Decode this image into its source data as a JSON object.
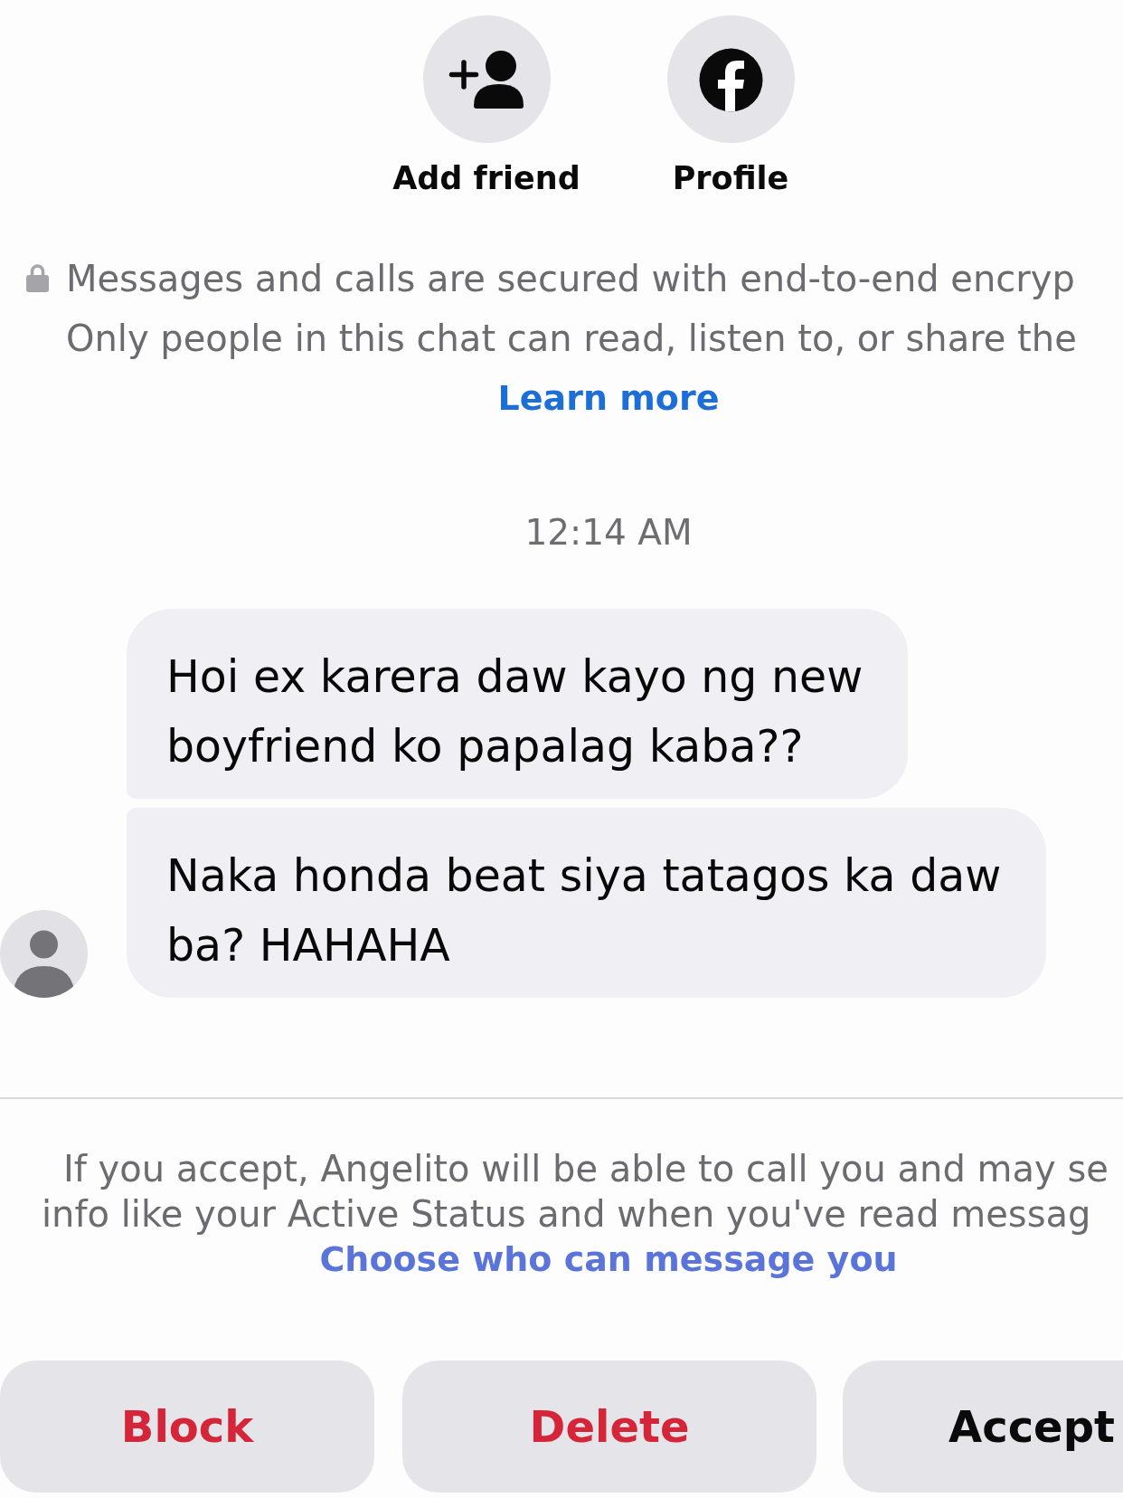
{
  "profile_actions": [
    {
      "kind": "add_friend",
      "label": "Add friend"
    },
    {
      "kind": "profile",
      "label": "Profile"
    }
  ],
  "encryption_notice": {
    "lines": [
      "Messages and calls are secured with end-to-end encryp",
      "Only people in this chat can read, listen to, or share the"
    ],
    "link": "Learn more"
  },
  "timestamp": "12:14 AM",
  "messages": [
    {
      "lines": [
        "Hoi ex karera daw kayo ng new",
        "boyfriend ko papalag kaba??"
      ]
    },
    {
      "lines": [
        "Naka honda beat siya tatagos ka daw",
        "ba? HAHAHA"
      ]
    }
  ],
  "request_notice": {
    "lines": [
      "If you accept, Angelito will be able to call you and may se",
      "info like your Active Status and when you've read messag"
    ],
    "link": "Choose who can message you"
  },
  "buttons": [
    {
      "kind": "block",
      "label": "Block"
    },
    {
      "kind": "delete",
      "label": "Delete"
    },
    {
      "kind": "accept",
      "label": "Accept"
    }
  ]
}
